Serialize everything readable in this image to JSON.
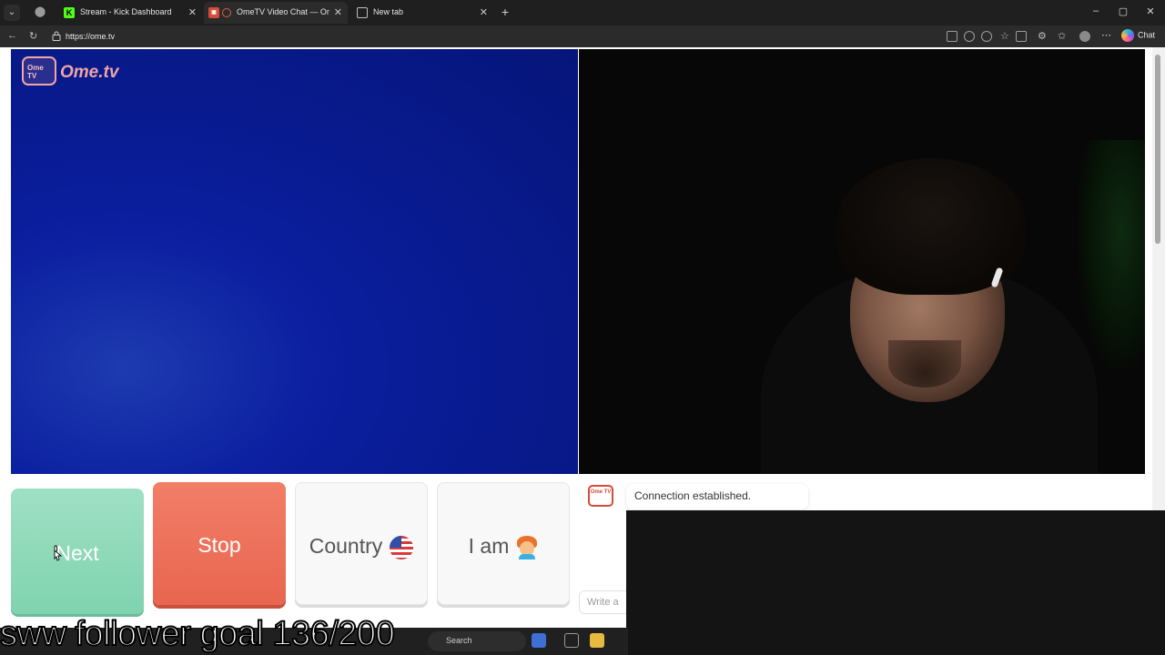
{
  "browser": {
    "tabs": [
      {
        "title": "Stream - Kick Dashboard",
        "active": false
      },
      {
        "title": "OmeTV Video Chat — Omeg",
        "active": true
      },
      {
        "title": "New tab",
        "active": false
      }
    ],
    "url": "https://ome.tv",
    "chat_label": "Chat"
  },
  "logo": {
    "tv_text": "Ome TV",
    "wordmark": "Ome.tv"
  },
  "controls": {
    "next_label": "Next",
    "stop_label": "Stop",
    "country_label": "Country",
    "iam_label": "I am"
  },
  "chat": {
    "logo_text": "Ome TV",
    "status_message": "Connection established.",
    "input_placeholder": "Write a"
  },
  "stream_overlay": {
    "text": "sww follower goal 136/200"
  },
  "taskbar": {
    "search_label": "Search"
  },
  "colors": {
    "next": "#7fd3ae",
    "stop": "#e8664f",
    "brand": "#d84b3b"
  }
}
